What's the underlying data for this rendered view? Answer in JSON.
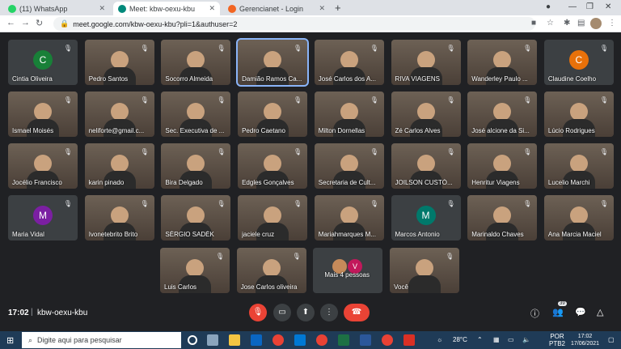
{
  "tabs": [
    {
      "label": "(11) WhatsApp",
      "color": "#25d366"
    },
    {
      "label": "Meet: kbw-oexu-kbu",
      "color": "#00897b"
    },
    {
      "label": "Gerencianet - Login",
      "color": "#f26522"
    }
  ],
  "address": {
    "url": "meet.google.com/kbw-oexu-kbu?pli=1&authuser=2"
  },
  "participants": [
    {
      "name": "Cintia Oliveira",
      "type": "avatar",
      "letter": "C",
      "color": "#188038"
    },
    {
      "name": "Pedro Santos",
      "type": "video"
    },
    {
      "name": "Socorro Almeida",
      "type": "video"
    },
    {
      "name": "Damião Ramos Ca...",
      "type": "video",
      "speaking": true
    },
    {
      "name": "José Carlos dos A...",
      "type": "video"
    },
    {
      "name": "RIVA VIAGENS",
      "type": "video"
    },
    {
      "name": "Wanderley Paulo ...",
      "type": "video"
    },
    {
      "name": "Claudine Coelho",
      "type": "avatar",
      "letter": "C",
      "color": "#e8710a"
    },
    {
      "name": "Ismael Moisés",
      "type": "video"
    },
    {
      "name": "neliforte@gmail.c...",
      "type": "video"
    },
    {
      "name": "Sec. Executiva de ...",
      "type": "video"
    },
    {
      "name": "Pedro Caetano",
      "type": "video"
    },
    {
      "name": "Milton Dornellas",
      "type": "video"
    },
    {
      "name": "Zé Carlos Alves",
      "type": "video"
    },
    {
      "name": "José alcione da Si...",
      "type": "video"
    },
    {
      "name": "Lúcio Rodrigues",
      "type": "video"
    },
    {
      "name": "Jocélio Francisco",
      "type": "video"
    },
    {
      "name": "karin pinado",
      "type": "video"
    },
    {
      "name": "Bira Delgado",
      "type": "video"
    },
    {
      "name": "Edgles Gonçalves",
      "type": "video"
    },
    {
      "name": "Secretaria de Cult...",
      "type": "video"
    },
    {
      "name": "JOILSON CUSTÓ...",
      "type": "video"
    },
    {
      "name": "Henritur Viagens",
      "type": "video"
    },
    {
      "name": "Lucelio Marchi",
      "type": "video"
    },
    {
      "name": "Maria Vidal",
      "type": "avatar",
      "letter": "M",
      "color": "#7b1fa2"
    },
    {
      "name": "Ivonetebrito Brito",
      "type": "video"
    },
    {
      "name": "SÉRGIO SADÉK",
      "type": "video"
    },
    {
      "name": "jaciele cruz",
      "type": "video"
    },
    {
      "name": "Mariahmarques M...",
      "type": "video"
    },
    {
      "name": "Marcos Antonio",
      "type": "avatar",
      "letter": "M",
      "color": "#00796b"
    },
    {
      "name": "Marinaldo Chaves",
      "type": "video"
    },
    {
      "name": "Ana Marcia Maciel",
      "type": "video"
    },
    {
      "name": "Luis Carlos",
      "type": "video"
    },
    {
      "name": "Jose Carlos oliveira",
      "type": "video"
    },
    {
      "name": "Mais 4 pessoas",
      "type": "more",
      "letter": "V"
    },
    {
      "name": "Você",
      "type": "video"
    }
  ],
  "meeting": {
    "time": "17:02",
    "separator": "|",
    "code": "kbw-oexu-kbu",
    "participant_count": "39"
  },
  "taskbar": {
    "search_placeholder": "Digite aqui para pesquisar",
    "temperature": "28°C",
    "language": "POR",
    "layout": "PTB2",
    "clock_time": "17:02",
    "clock_date": "17/06/2021"
  }
}
